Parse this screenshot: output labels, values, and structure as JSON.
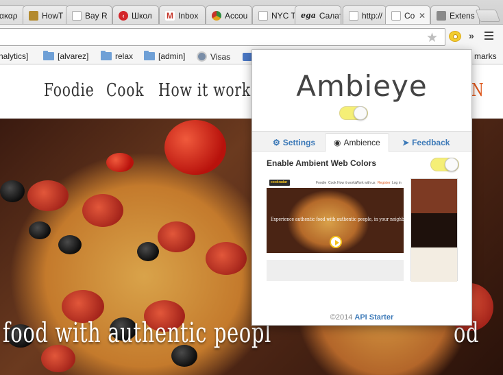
{
  "browser": {
    "tabs": [
      {
        "label": "ακαρ",
        "fav_color": "#9a9a9a",
        "fav_glyph": ""
      },
      {
        "label": "HowT",
        "fav_color": "#b38a2e",
        "fav_glyph": ""
      },
      {
        "label": "Bay R",
        "fav_color": "#ffffff",
        "fav_glyph": ""
      },
      {
        "label": "Школ",
        "fav_color": "#d3262b",
        "fav_glyph": "‹"
      },
      {
        "label": "Inbox",
        "fav_color": "#c5362a",
        "fav_glyph": "M"
      },
      {
        "label": "Accou",
        "fav_color": "#2e8b3d",
        "fav_glyph": ""
      },
      {
        "label": "NYC T",
        "fav_color": "#ffffff",
        "fav_glyph": ""
      },
      {
        "label": "Салат",
        "fav_color": "#ffffff",
        "fav_glyph": "ega"
      },
      {
        "label": "http://",
        "fav_color": "#ffffff",
        "fav_glyph": ""
      },
      {
        "label": "Co",
        "fav_color": "#ffffff",
        "fav_glyph": "",
        "active": true
      },
      {
        "label": "Extens",
        "fav_color": "#8a8a8a",
        "fav_glyph": ""
      }
    ],
    "bookmarks": [
      {
        "label": "nalytics]",
        "type": "text"
      },
      {
        "label": "[alvarez]",
        "type": "folder"
      },
      {
        "label": "relax",
        "type": "folder"
      },
      {
        "label": "[admin]",
        "type": "folder"
      },
      {
        "label": "Visas",
        "type": "seal"
      },
      {
        "label": "marks",
        "type": "text"
      }
    ]
  },
  "site": {
    "nav": [
      "Foodie",
      "Cook",
      "How it works",
      "N"
    ],
    "hero_left": "food with authentic peopl",
    "hero_right": "od"
  },
  "popup": {
    "title": "Ambieye",
    "tabs": [
      {
        "label": "Settings",
        "icon": "gear-icon"
      },
      {
        "label": "Ambience",
        "icon": "eye-icon"
      },
      {
        "label": "Feedback",
        "icon": "send-icon"
      }
    ],
    "enable_label": "Enable Ambient Web Colors",
    "preview": {
      "logo": "cookradar",
      "nav": [
        "Foodie",
        "Cook",
        "How it works",
        "Work with us",
        "Register",
        "Log in"
      ],
      "caption": "Experience authentic food with authentic people, in your neighborhood"
    },
    "swatches": [
      "#7d3a23",
      "#1e110c",
      "#f3ede2"
    ],
    "footer_prefix": "©2014",
    "footer_link": "API Starter"
  },
  "colors": {
    "link": "#3d7ab8",
    "toggle_on": "#f5ef76",
    "accent_orange": "#e0591d"
  }
}
